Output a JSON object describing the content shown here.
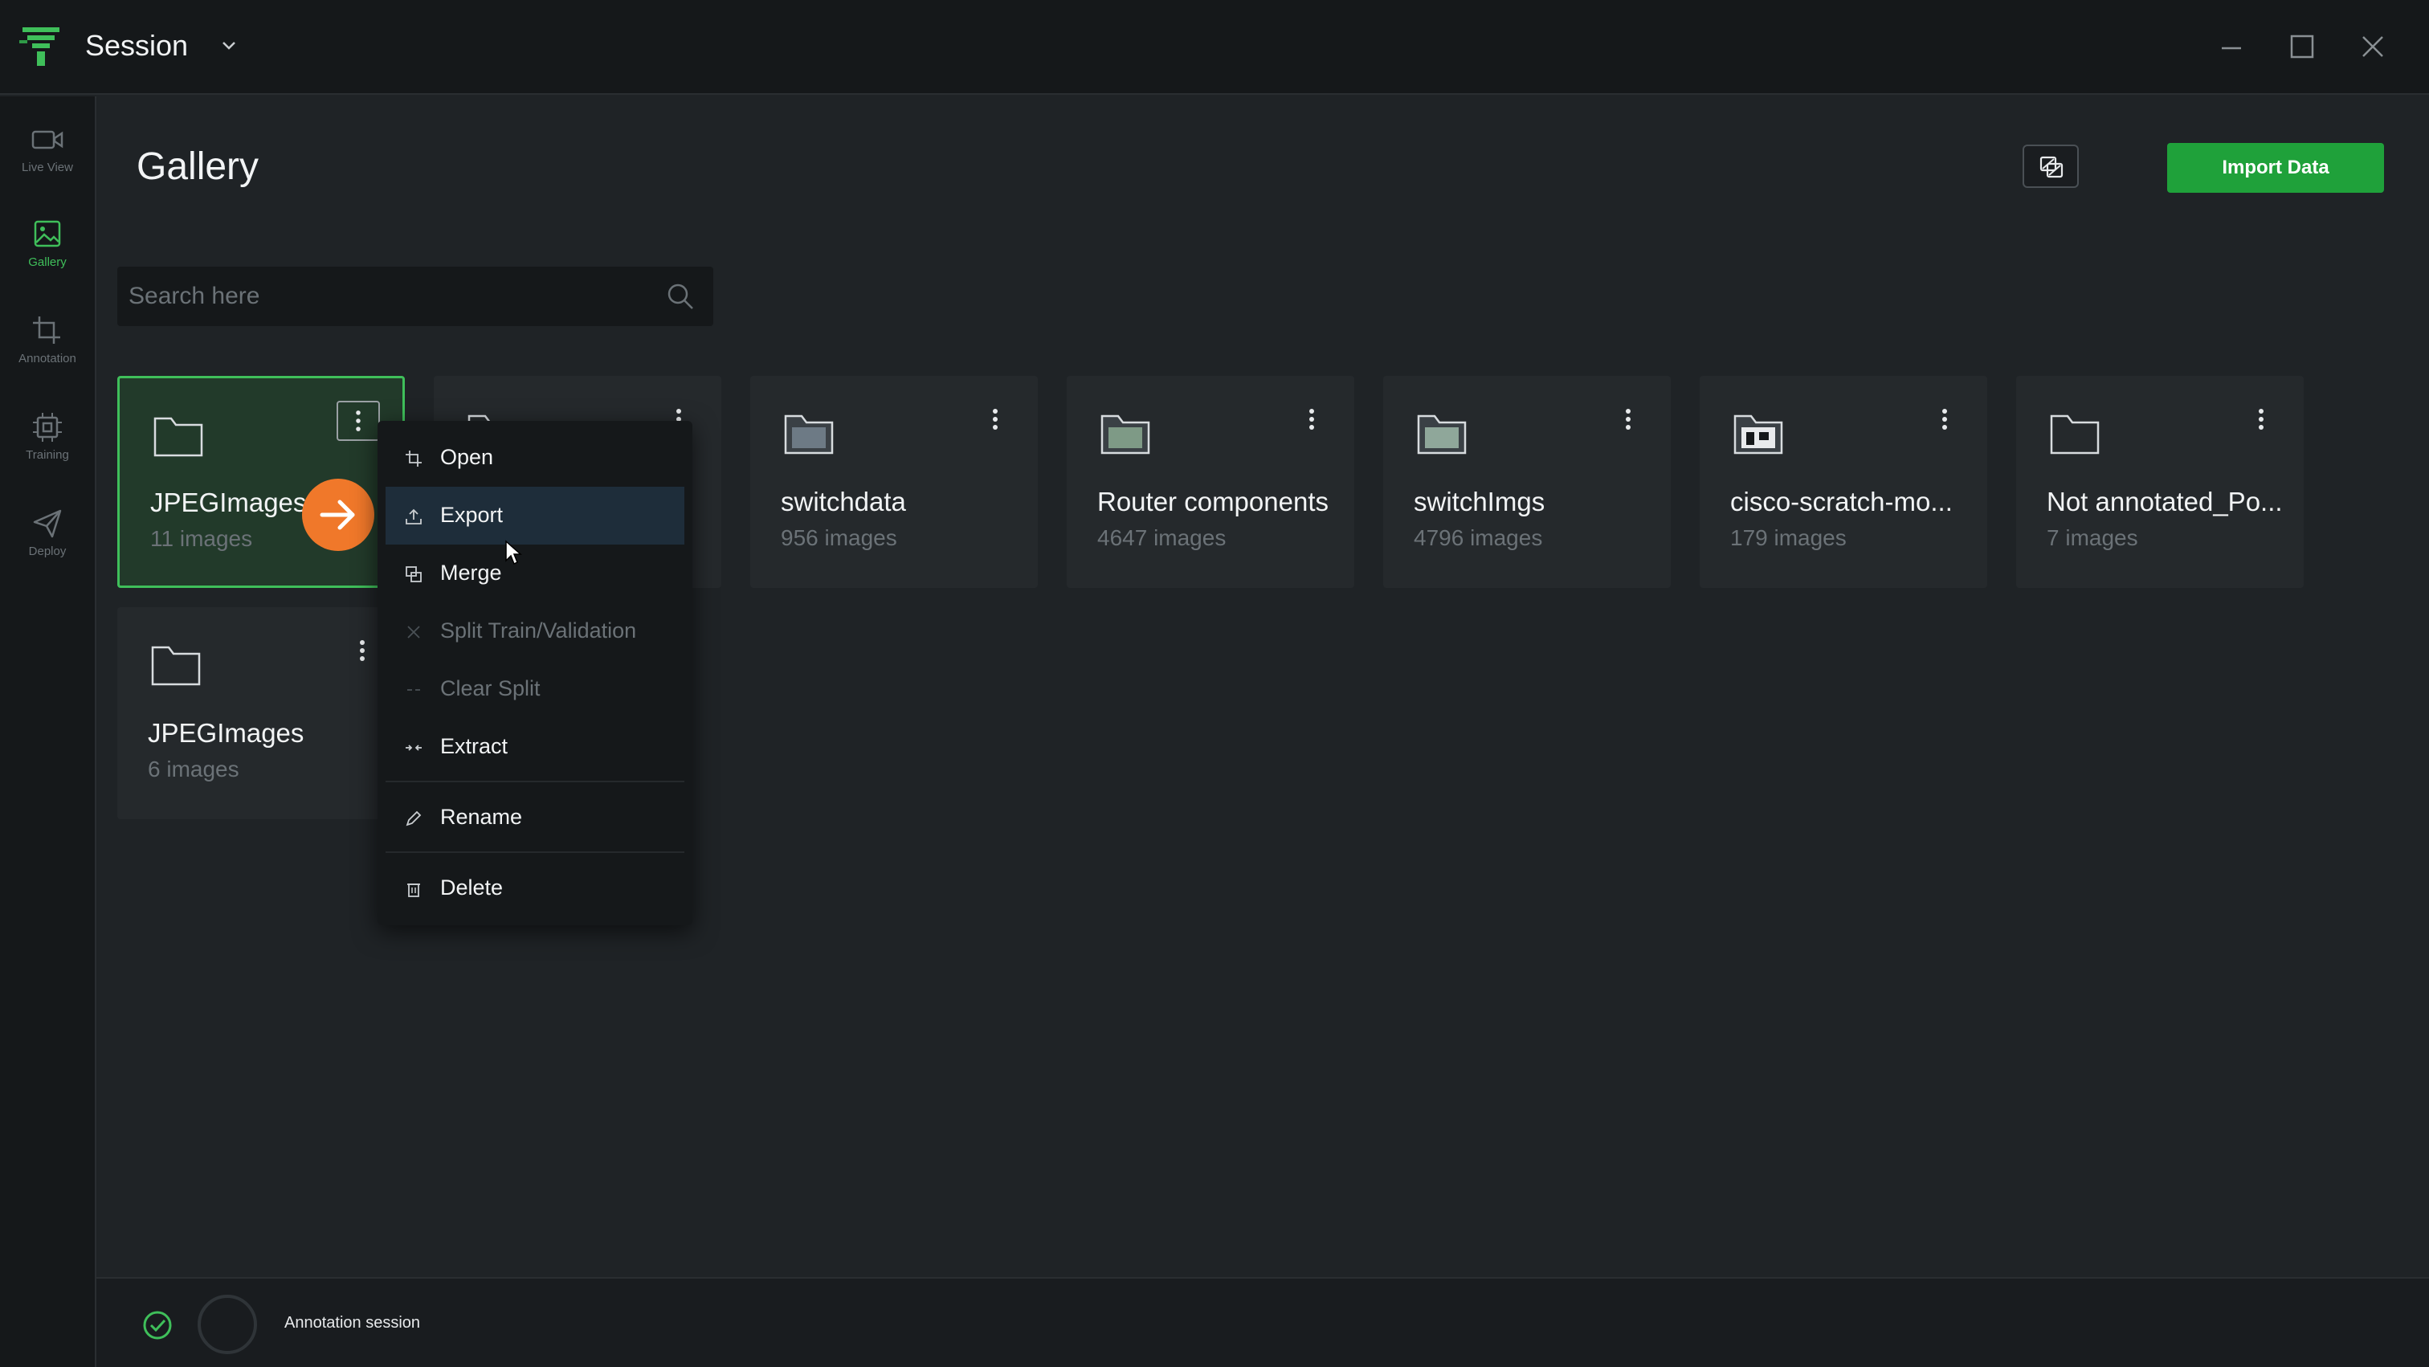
{
  "titlebar": {
    "session_label": "Session",
    "icons": [
      "app-logo",
      "chevron-down-icon",
      "minimize-icon",
      "maximize-icon",
      "close-icon"
    ]
  },
  "sidebar": {
    "items": [
      {
        "label": "Live View",
        "icon": "video-camera-icon",
        "active": false
      },
      {
        "label": "Gallery",
        "icon": "image-icon",
        "active": true
      },
      {
        "label": "Annotation",
        "icon": "crop-icon",
        "active": false
      },
      {
        "label": "Training",
        "icon": "chip-icon",
        "active": false
      },
      {
        "label": "Deploy",
        "icon": "send-icon",
        "active": false
      }
    ]
  },
  "header": {
    "title": "Gallery",
    "import_label": "Import Data",
    "merge_icon": "merge-images-icon"
  },
  "search": {
    "placeholder": "Search here",
    "value": ""
  },
  "datasets": [
    {
      "name": "JPEGImages_",
      "count": "11 images",
      "selected": true
    },
    {
      "name": "",
      "count": "",
      "selected": false
    },
    {
      "name": "switchdata",
      "count": "956 images",
      "selected": false
    },
    {
      "name": "Router components",
      "count": "4647 images",
      "selected": false
    },
    {
      "name": "switchImgs",
      "count": "4796 images",
      "selected": false
    },
    {
      "name": "cisco-scratch-mo...",
      "count": "179 images",
      "selected": false
    },
    {
      "name": "Not annotated_Po...",
      "count": "7 images",
      "selected": false
    },
    {
      "name": "JPEGImages",
      "count": "6 images",
      "selected": false
    }
  ],
  "context_menu": {
    "items": [
      {
        "label": "Open",
        "icon": "crop-icon",
        "enabled": true
      },
      {
        "label": "Export",
        "icon": "upload-icon",
        "enabled": true,
        "hover": true
      },
      {
        "label": "Merge",
        "icon": "merge-icon",
        "enabled": true
      },
      {
        "label": "Split Train/Validation",
        "icon": "split-icon",
        "enabled": false
      },
      {
        "label": "Clear Split",
        "icon": "clear-split-icon",
        "enabled": false
      },
      {
        "label": "Extract",
        "icon": "extract-icon",
        "enabled": true
      },
      {
        "label": "Rename",
        "icon": "pencil-icon",
        "enabled": true
      },
      {
        "label": "Delete",
        "icon": "trash-icon",
        "enabled": true
      }
    ]
  },
  "statusbar": {
    "text": "Annotation session"
  },
  "colors": {
    "accent": "#3fbf5a",
    "import_button": "#1fa13a",
    "arrow_badge": "#f0782a",
    "background": "#1f2326",
    "panel": "#15181a"
  }
}
